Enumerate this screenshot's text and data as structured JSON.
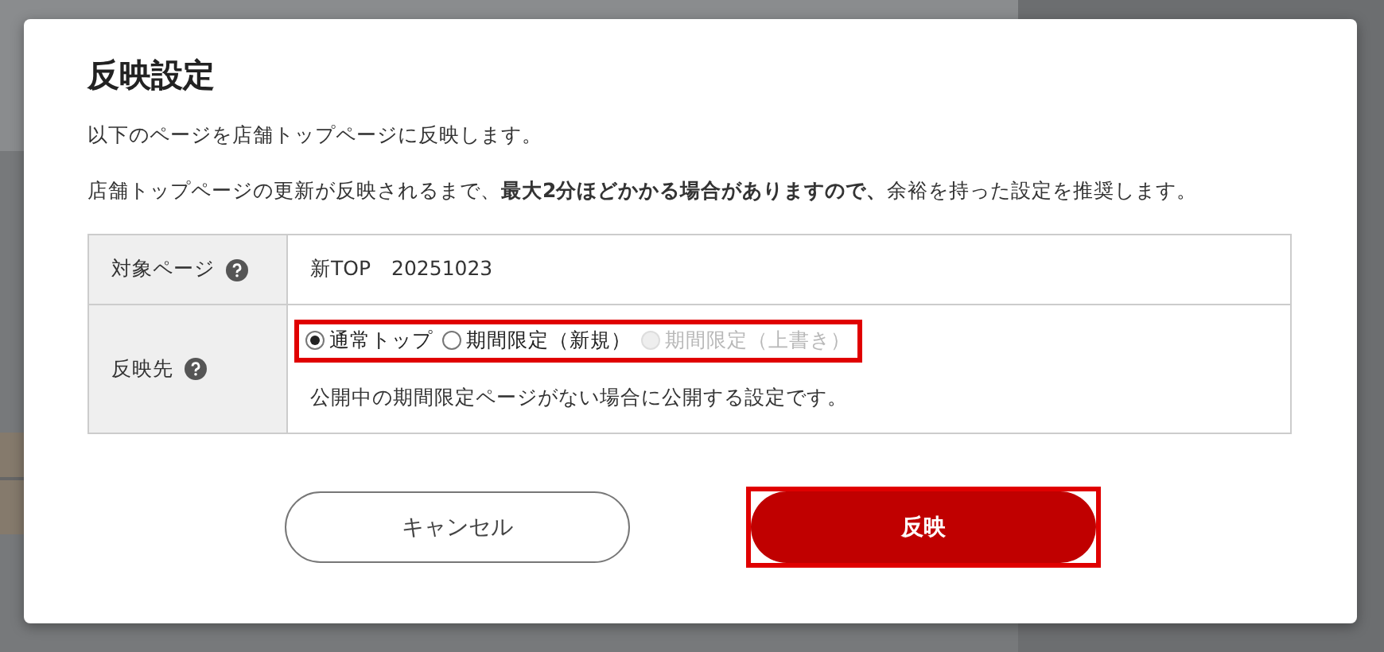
{
  "dialog": {
    "title": "反映設定",
    "description": "以下のページを店舗トップページに反映します。",
    "notice": "店舗トップページの更新が反映されるまで、**最大2分ほどかかる場合がありますので、**余裕を持った設定を推奨します。",
    "rows": [
      {
        "label": "対象ページ",
        "kind": "text",
        "value": "新TOP　20251023"
      },
      {
        "label": "反映先",
        "kind": "radios",
        "options": [
          {
            "label": "通常トップ",
            "selected": true,
            "disabled": false
          },
          {
            "label": "期間限定（新規）",
            "selected": false,
            "disabled": false
          },
          {
            "label": "期間限定（上書き）",
            "selected": false,
            "disabled": true
          }
        ],
        "note": "公開中の期間限定ページがない場合に公開する設定です。"
      }
    ],
    "buttons": [
      {
        "label": "キャンセル",
        "kind": "secondary"
      },
      {
        "label": "反映",
        "kind": "primary"
      }
    ]
  }
}
